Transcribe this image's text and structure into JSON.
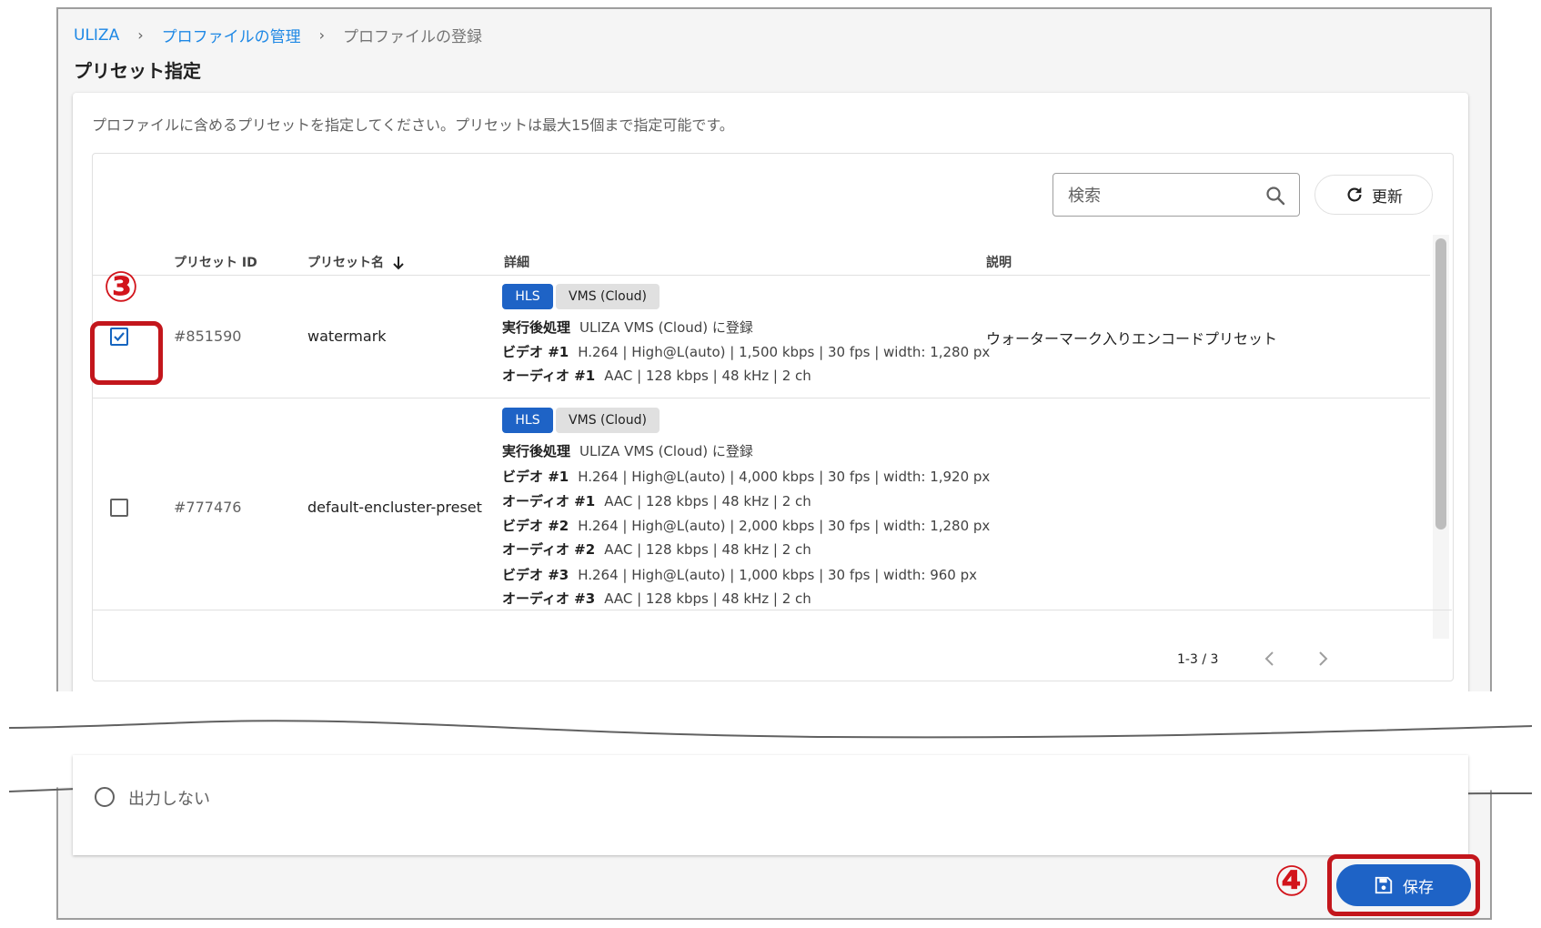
{
  "breadcrumb": {
    "root": "ULIZA",
    "parent": "プロファイルの管理",
    "current": "プロファイルの登録",
    "sep": "›"
  },
  "page_title": "プリセット指定",
  "description": "プロファイルに含めるプリセットを指定してください。プリセットは最大15個まで指定可能です。",
  "search": {
    "placeholder": "検索",
    "icon": "search-icon"
  },
  "refresh_label": "更新",
  "columns": {
    "id": "プリセット ID",
    "name": "プリセット名",
    "detail": "詳細",
    "desc": "説明"
  },
  "rows": [
    {
      "checked": true,
      "id": "#851590",
      "name": "watermark",
      "chips": [
        "HLS",
        "VMS (Cloud)"
      ],
      "details": [
        {
          "label": "実行後処理",
          "value": "ULIZA VMS (Cloud) に登録"
        },
        {
          "label": "ビデオ #1",
          "value": "H.264 | High@L(auto) | 1,500 kbps | 30 fps | width: 1,280 px"
        },
        {
          "label": "オーディオ #1",
          "value": "AAC | 128 kbps | 48 kHz | 2 ch"
        }
      ],
      "description": "ウォーターマーク入りエンコードプリセット"
    },
    {
      "checked": false,
      "id": "#777476",
      "name": "default-encluster-preset",
      "chips": [
        "HLS",
        "VMS (Cloud)"
      ],
      "details": [
        {
          "label": "実行後処理",
          "value": "ULIZA VMS (Cloud) に登録"
        },
        {
          "label": "ビデオ #1",
          "value": "H.264 | High@L(auto) | 4,000 kbps | 30 fps | width: 1,920 px"
        },
        {
          "label": "オーディオ #1",
          "value": "AAC | 128 kbps | 48 kHz | 2 ch"
        },
        {
          "label": "ビデオ #2",
          "value": "H.264 | High@L(auto) | 2,000 kbps | 30 fps | width: 1,280 px"
        },
        {
          "label": "オーディオ #2",
          "value": "AAC | 128 kbps | 48 kHz | 2 ch"
        },
        {
          "label": "ビデオ #3",
          "value": "H.264 | High@L(auto) | 1,000 kbps | 30 fps | width: 960 px"
        },
        {
          "label": "オーディオ #3",
          "value": "AAC | 128 kbps | 48 kHz | 2 ch"
        }
      ],
      "description": ""
    }
  ],
  "pagination": {
    "range": "1-3 / 3"
  },
  "output_option": "出力しない",
  "save_label": "保存",
  "annotations": {
    "step3": "③",
    "step4": "④",
    "color": "#c3161c"
  },
  "colors": {
    "primary": "#1e63c6",
    "link": "#1e88e5"
  }
}
